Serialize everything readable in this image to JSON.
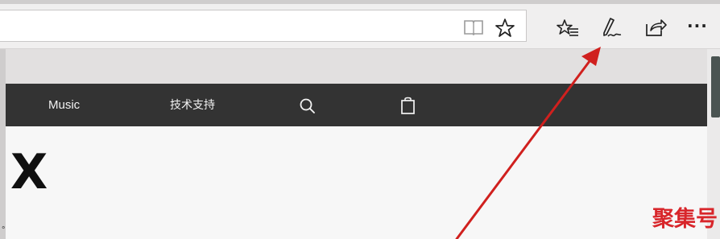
{
  "browser": {
    "toolbar_icons": [
      "reading-view-icon",
      "favorite-star-icon",
      "favorites-hub-icon",
      "web-note-pen-icon",
      "share-icon",
      "more-ellipsis-icon"
    ],
    "more_label": "···"
  },
  "site_nav": {
    "items": [
      {
        "label": "Music"
      },
      {
        "label": "技术支持"
      }
    ],
    "icons": [
      "search-icon",
      "shopping-bag-icon"
    ]
  },
  "page": {
    "heading": "X",
    "corner_glyph": "°"
  },
  "annotation": {
    "color": "#d0201e"
  },
  "watermark": {
    "text": "聚集号",
    "color": "#d8262b"
  },
  "colors": {
    "navbar": "#333333",
    "toolbar": "#f0efef",
    "page": "#f7f7f7"
  }
}
